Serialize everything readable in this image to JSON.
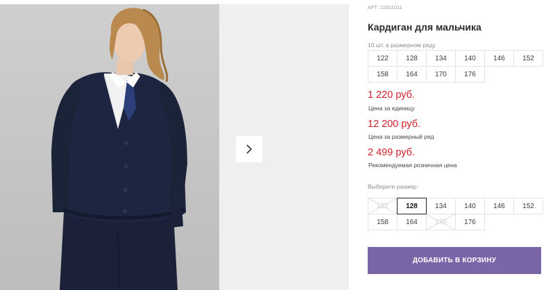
{
  "product": {
    "sku": "АРТ: 22011011",
    "title": "Кардиган для мальчика"
  },
  "gallery": {
    "photo_alt": "boy-in-navy-cardigan",
    "next_icon": "chevron-right-icon"
  },
  "pack": {
    "note": "10 шт. в размерном ряду",
    "sizes": [
      "122",
      "128",
      "134",
      "140",
      "146",
      "152",
      "158",
      "164",
      "170",
      "176"
    ]
  },
  "prices": {
    "unit_price": "1 220 руб.",
    "unit_label": "Цена за единицу",
    "pack_price": "12 200 руб.",
    "pack_label": "Цена за размерный ряд",
    "retail_price": "2 499 руб.",
    "retail_label": "Рекомендуемая розничная цена"
  },
  "size_select": {
    "label": "Выберите размер:",
    "options": [
      {
        "size": "122",
        "state": "disabled"
      },
      {
        "size": "128",
        "state": "selected"
      },
      {
        "size": "134",
        "state": "available"
      },
      {
        "size": "140",
        "state": "available"
      },
      {
        "size": "146",
        "state": "available"
      },
      {
        "size": "152",
        "state": "available"
      },
      {
        "size": "158",
        "state": "available"
      },
      {
        "size": "164",
        "state": "available"
      },
      {
        "size": "170",
        "state": "disabled"
      },
      {
        "size": "176",
        "state": "available"
      }
    ]
  },
  "cta": {
    "add_to_cart": "ДОБАВИТЬ В КОРЗИНУ"
  },
  "colors": {
    "price": "#d11f2c",
    "button": "#7a65a9",
    "cardigan": "#1d2540"
  }
}
